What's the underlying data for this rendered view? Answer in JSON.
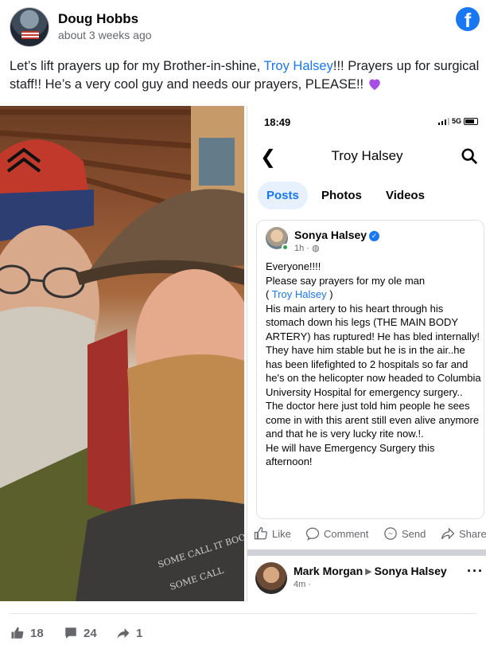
{
  "post": {
    "author": "Doug Hobbs",
    "time": "about 3 weeks ago",
    "brand_icon": "facebook-logo-icon",
    "caption_before": "Let’s lift prayers up for my Brother-in-shine, ",
    "caption_link": "Troy Halsey",
    "caption_after": "!!! Prayers up for surgical staff!! He’s a very cool guy and needs our prayers, PLEASE!! ",
    "caption_emoji": "purple-heart-icon"
  },
  "photo": {
    "shirt_text_1": "SOME CALL IT BOOTLEGGIN'",
    "shirt_text_2": "SOME CALL"
  },
  "screenshot": {
    "status_time": "18:49",
    "network": "5G",
    "title": "Troy Halsey",
    "tabs": [
      "Posts",
      "Photos",
      "Videos"
    ],
    "post": {
      "author": "Sonya Halsey",
      "time": "1h ·",
      "line1": "Everyone!!!!",
      "line2": "Please say prayers for my ole man",
      "tag_open": "( ",
      "tag_link": "Troy Halsey",
      "tag_close": " )",
      "body": "His main artery to his heart through his stomach down his legs (THE MAIN BODY ARTERY) has ruptured! He has bled internally! They have him stable but he is in the air..he has been lifefighted to 2 hospitals so far and he's on the helicopter now headed to Columbia University Hospital for emergency surgery..",
      "body2": "The doctor here just told him people he sees come in with this arent still even alive anymore and that he is very lucky rite now.!.",
      "body3": "He will have Emergency Surgery this afternoon!"
    },
    "actions": [
      "Like",
      "Comment",
      "Send",
      "Share"
    ],
    "next_post": {
      "author": "Mark Morgan",
      "target": "Sonya Halsey",
      "time": "4m ·"
    }
  },
  "reactions": {
    "likes": "18",
    "comments": "24",
    "shares": "1"
  },
  "colors": {
    "facebook_blue": "#1877f2",
    "text": "#1c1e21",
    "secondary": "#65676b",
    "heart": "#8e44ad"
  }
}
